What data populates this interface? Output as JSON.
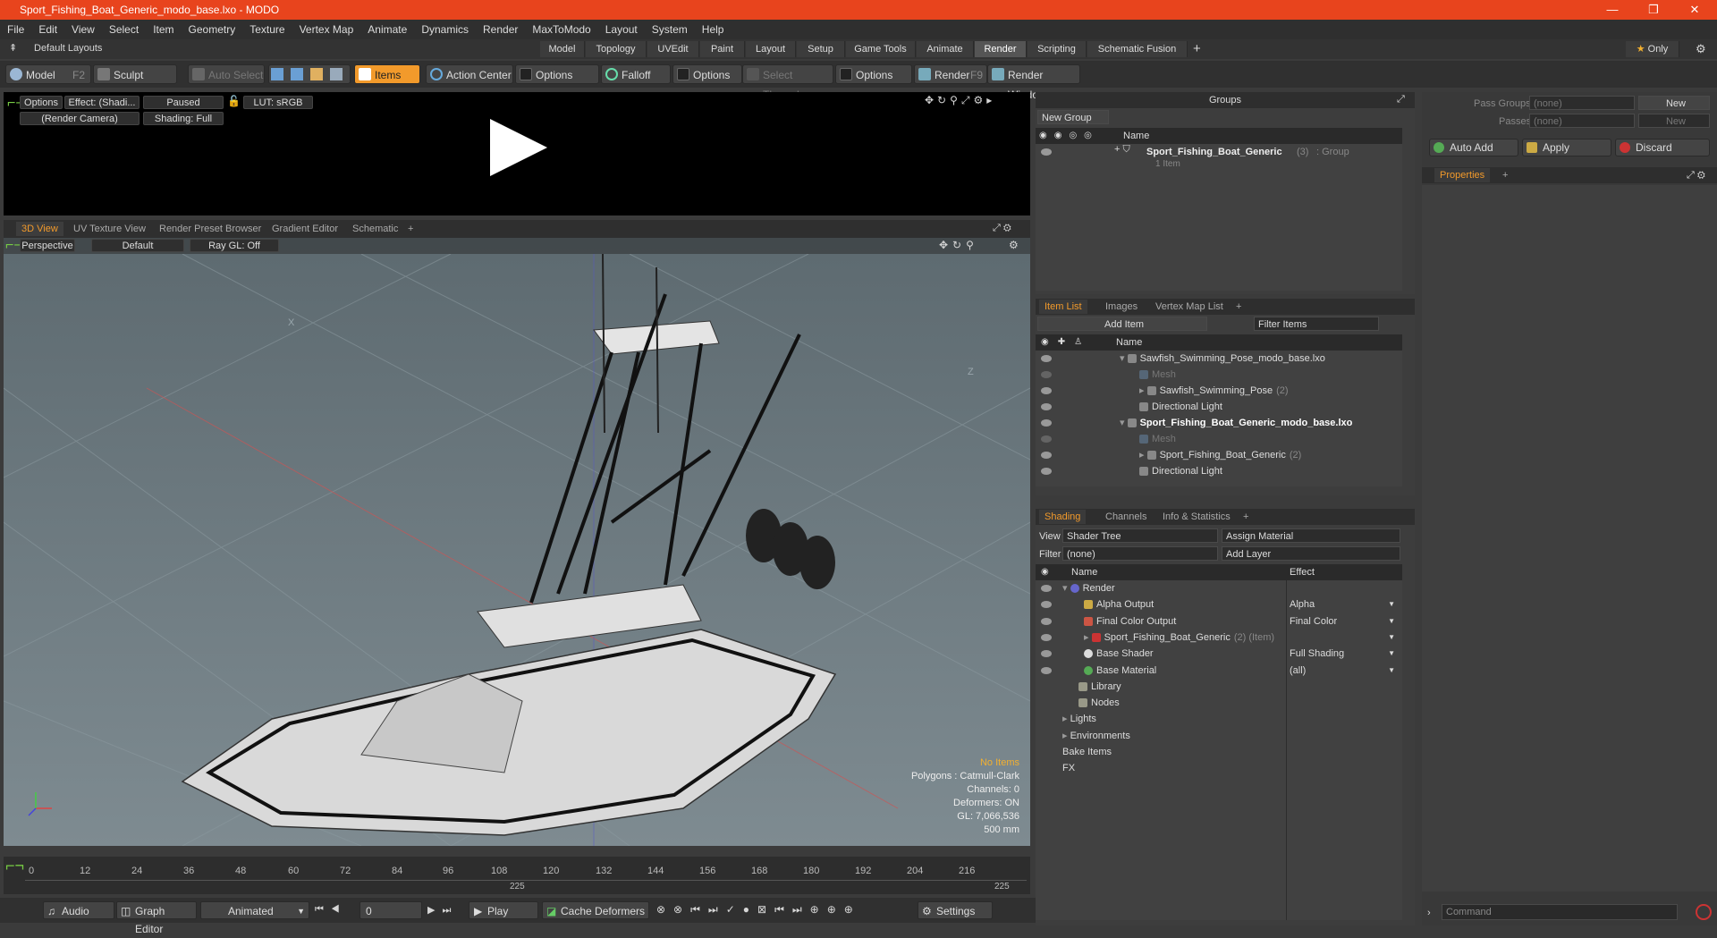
{
  "window": {
    "title": "Sport_Fishing_Boat_Generic_modo_base.lxo - MODO",
    "min": "—",
    "max": "❐",
    "close": "✕"
  },
  "menu": [
    "File",
    "Edit",
    "View",
    "Select",
    "Item",
    "Geometry",
    "Texture",
    "Vertex Map",
    "Animate",
    "Dynamics",
    "Render",
    "MaxToModo",
    "Layout",
    "System",
    "Help"
  ],
  "layouts": {
    "label": "Default Layouts",
    "tabs": [
      "Model",
      "Topology",
      "UVEdit",
      "Paint",
      "Layout",
      "Setup",
      "Game Tools",
      "Animate",
      "Render",
      "Scripting",
      "Schematic Fusion"
    ],
    "active": "Render",
    "plus": "+",
    "only": "Only"
  },
  "toolbar": {
    "model": "Model",
    "model_key": "F2",
    "sculpt": "Sculpt",
    "auto_select": "Auto Select",
    "items": "Items",
    "action_center": "Action Center",
    "options1": "Options",
    "falloff": "Falloff",
    "options2": "Options",
    "select_through": "Select Through",
    "options3": "Options",
    "render": "Render",
    "render_key": "F9",
    "render_window": "Render Window"
  },
  "render_preview": {
    "options": "Options",
    "effect": "Effect: (Shadi...",
    "paused": "Paused",
    "lut": "LUT: sRGB",
    "camera": "(Render Camera)",
    "shading": "Shading: Full"
  },
  "view_tabs": [
    "3D View",
    "UV Texture View",
    "Render Preset Browser",
    "Gradient Editor",
    "Schematic"
  ],
  "viewport": {
    "options": "Options",
    "perspective": "Perspective",
    "default": "Default",
    "raygl": "Ray GL: Off",
    "stats": {
      "no_items": "No Items",
      "polygons": "Polygons : Catmull-Clark",
      "channels": "Channels: 0",
      "deformers": "Deformers: ON",
      "gl": "GL: 7,066,536",
      "size": "500 mm"
    }
  },
  "timeline": {
    "ticks": [
      "0",
      "12",
      "24",
      "36",
      "48",
      "60",
      "72",
      "84",
      "96",
      "108",
      "120",
      "132",
      "144",
      "156",
      "168",
      "180",
      "192",
      "204",
      "216"
    ],
    "end_left": "225",
    "end_right": "225"
  },
  "bottom": {
    "audio": "Audio",
    "graph_editor": "Graph Editor",
    "animated": "Animated",
    "frame": "0",
    "play": "Play",
    "cache": "Cache Deformers",
    "settings": "Settings"
  },
  "groups": {
    "title": "Groups",
    "new_group": "New Group",
    "col_name": "Name",
    "item": "Sport_Fishing_Boat_Generic",
    "item_count": "(3)",
    "item_type": ": Group",
    "item_sub": "1 Item"
  },
  "item_list": {
    "tabs": [
      "Item List",
      "Images",
      "Vertex Map List"
    ],
    "add_item": "Add Item",
    "filter": "Filter Items",
    "col_name": "Name",
    "rows": [
      {
        "label": "Sawfish_Swimming_Pose_modo_base.lxo",
        "indent": 0,
        "bold": false
      },
      {
        "label": "Mesh",
        "indent": 1,
        "gray": true
      },
      {
        "label": "Sawfish_Swimming_Pose",
        "count": "(2)",
        "indent": 1
      },
      {
        "label": "Directional Light",
        "indent": 1
      },
      {
        "label": "Sport_Fishing_Boat_Generic_modo_base.lxo",
        "indent": 0,
        "bold": true
      },
      {
        "label": "Mesh",
        "indent": 1,
        "gray": true
      },
      {
        "label": "Sport_Fishing_Boat_Generic",
        "count": "(2)",
        "indent": 1
      },
      {
        "label": "Directional Light",
        "indent": 1
      }
    ]
  },
  "shading": {
    "tabs": [
      "Shading",
      "Channels",
      "Info & Statistics"
    ],
    "view_label": "View",
    "view_value": "Shader Tree",
    "assign": "Assign Material",
    "filter_label": "Filter",
    "filter_value": "(none)",
    "add_layer": "Add Layer",
    "col_name": "Name",
    "col_effect": "Effect",
    "rows": [
      {
        "label": "Render",
        "effect": ""
      },
      {
        "label": "Alpha Output",
        "effect": "Alpha"
      },
      {
        "label": "Final Color Output",
        "effect": "Final Color"
      },
      {
        "label": "Sport_Fishing_Boat_Generic",
        "count": "(2) (Item)",
        "effect": ""
      },
      {
        "label": "Base Shader",
        "effect": "Full Shading"
      },
      {
        "label": "Base Material",
        "effect": "(all)"
      },
      {
        "label": "Library",
        "effect": ""
      },
      {
        "label": "Nodes",
        "effect": ""
      },
      {
        "label": "Lights",
        "effect": ""
      },
      {
        "label": "Environments",
        "effect": ""
      },
      {
        "label": "Bake Items",
        "effect": ""
      },
      {
        "label": "FX",
        "effect": ""
      }
    ]
  },
  "pass": {
    "pass_groups": "Pass Groups",
    "passes": "Passes",
    "none": "(none)",
    "new": "New",
    "auto_add": "Auto Add",
    "apply": "Apply",
    "discard": "Discard",
    "properties": "Properties",
    "command": "Command"
  },
  "axes": {
    "x": "X",
    "z": "Z"
  }
}
